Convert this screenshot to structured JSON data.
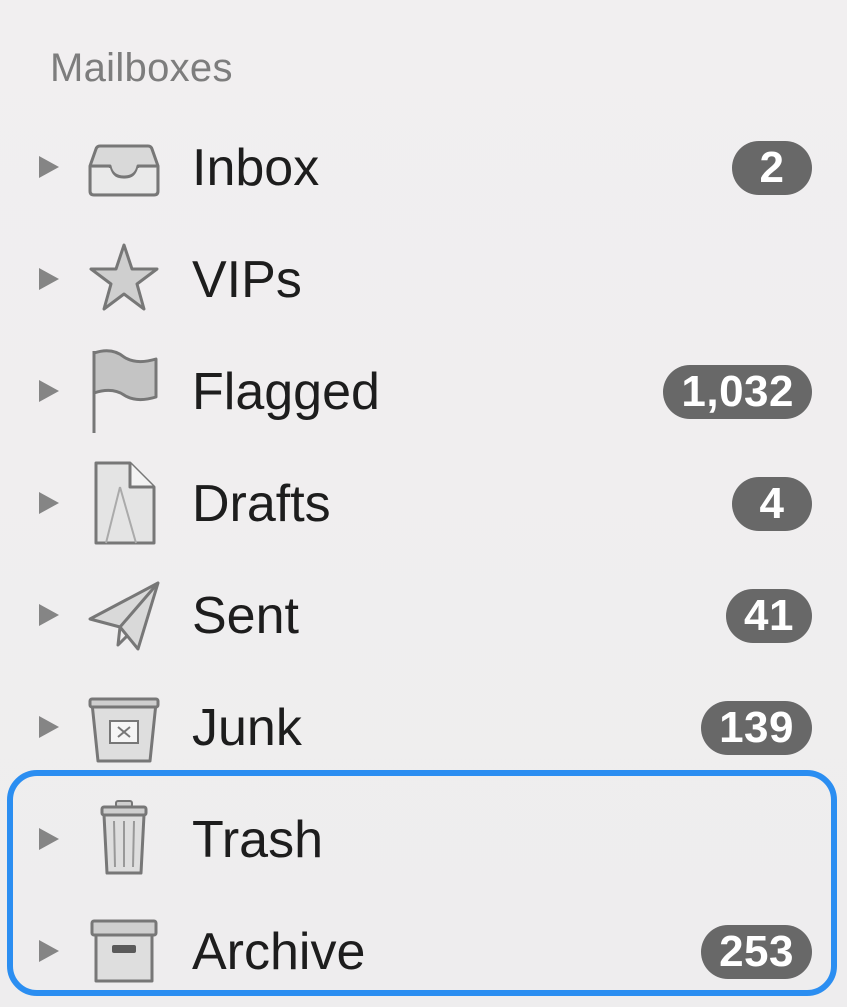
{
  "section": {
    "title": "Mailboxes"
  },
  "mailboxes": [
    {
      "label": "Inbox",
      "badge": "2",
      "icon": "inbox-tray-icon"
    },
    {
      "label": "VIPs",
      "badge": "",
      "icon": "star-icon"
    },
    {
      "label": "Flagged",
      "badge": "1,032",
      "icon": "flag-icon"
    },
    {
      "label": "Drafts",
      "badge": "4",
      "icon": "draft-document-icon"
    },
    {
      "label": "Sent",
      "badge": "41",
      "icon": "paper-plane-icon"
    },
    {
      "label": "Junk",
      "badge": "139",
      "icon": "junk-box-icon"
    },
    {
      "label": "Trash",
      "badge": "",
      "icon": "trash-can-icon"
    },
    {
      "label": "Archive",
      "badge": "253",
      "icon": "archive-box-icon"
    }
  ],
  "colors": {
    "badge_background": "#686868",
    "highlight_outline": "#2b8ef1",
    "icon_stroke": "#777777",
    "icon_fill": "#d2d2d2"
  }
}
